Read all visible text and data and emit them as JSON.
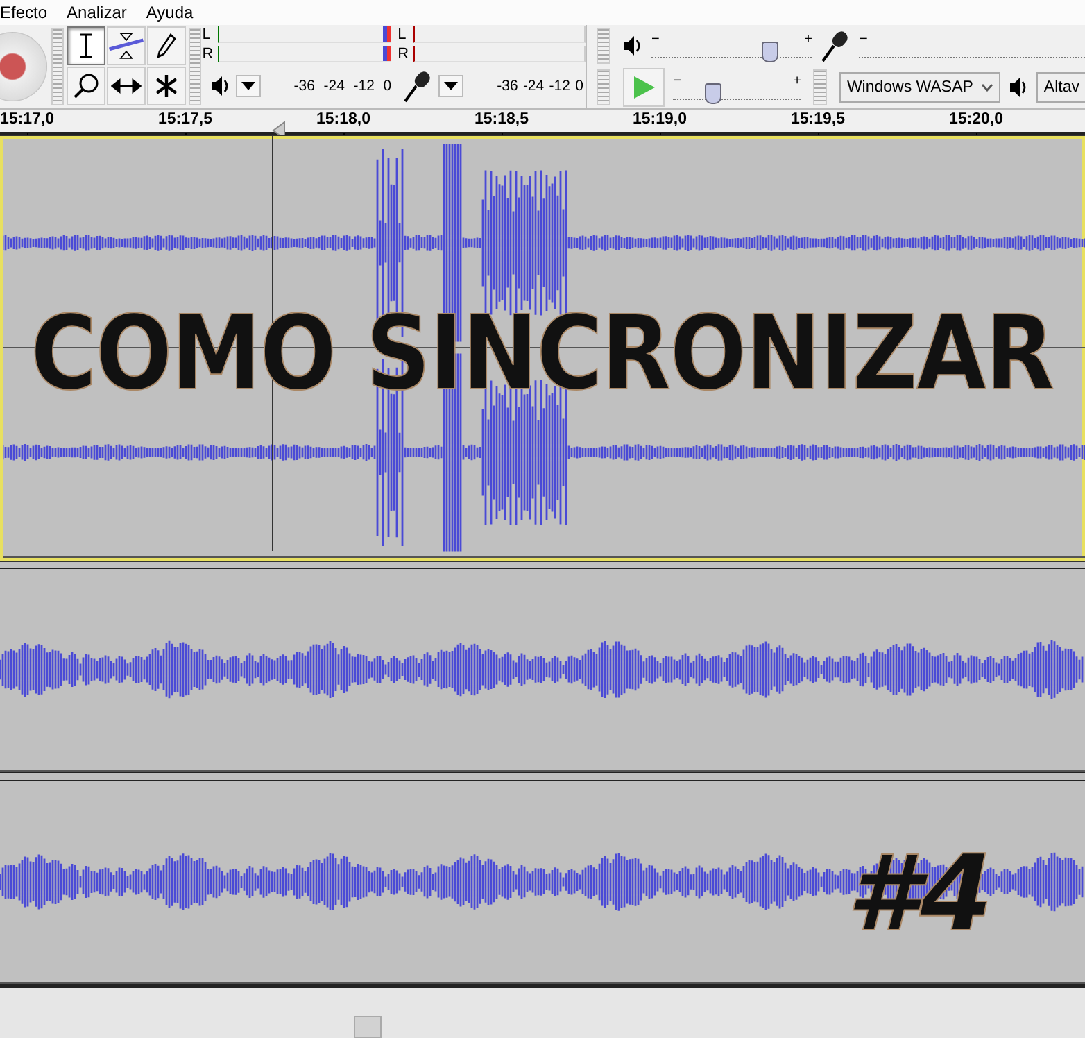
{
  "menu": [
    "Efecto",
    "Analizar",
    "Ayuda"
  ],
  "tools": [
    {
      "kind": "select",
      "selected": true
    },
    {
      "kind": "envelope",
      "selected": false
    },
    {
      "kind": "draw",
      "selected": false
    },
    {
      "kind": "zoom",
      "selected": false
    },
    {
      "kind": "timeshift",
      "selected": false
    },
    {
      "kind": "multi",
      "selected": false
    }
  ],
  "meters": [
    {
      "kind": "playback",
      "channels": [
        "L",
        "R"
      ],
      "ticks": [
        "-36",
        "-24",
        "-12",
        "0"
      ]
    },
    {
      "kind": "record",
      "channels": [
        "L",
        "R"
      ],
      "ticks": [
        "-36",
        "-24",
        "-12",
        "0"
      ]
    }
  ],
  "mixer": {
    "playback_volume": {
      "minus": "−",
      "plus": "+",
      "level": 0.73
    },
    "record_volume": {
      "minus": "−"
    }
  },
  "transcription": {
    "minus": "−",
    "plus": "+",
    "level": 0.3
  },
  "devices": {
    "host": "Windows WASAP",
    "output": "Altav"
  },
  "ruler": [
    "15:17,0",
    "15:17,5",
    "15:18,0",
    "15:18,5",
    "15:19,0",
    "15:19,5",
    "15:20,0"
  ],
  "tracks": [
    {
      "kind": "stereo",
      "selected": true
    },
    {
      "kind": "mono",
      "selected": false
    },
    {
      "kind": "mono",
      "selected": false
    }
  ],
  "overlay": {
    "title": "COMO SINCRONIZAR",
    "number": "#4"
  }
}
